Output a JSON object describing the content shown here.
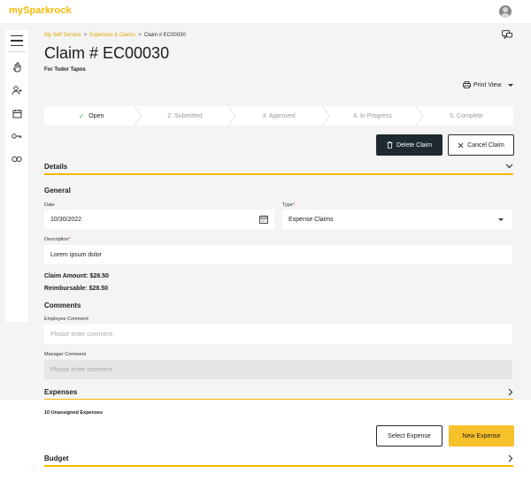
{
  "app": {
    "logo": "mySparkrock"
  },
  "breadcrumb": {
    "item1": "My Self Service",
    "item2": "Expenses & Claims",
    "item3": "Claim # EC00030",
    "sep": ">"
  },
  "header": {
    "title": "Claim # EC00030",
    "subtitle": "For Tudor Tapos",
    "print_view": "Print View"
  },
  "steps": [
    {
      "label": "Open"
    },
    {
      "label": "2. Submitted"
    },
    {
      "label": "3. Approved"
    },
    {
      "label": "4. In Progress"
    },
    {
      "label": "5. Complete"
    }
  ],
  "actions": {
    "delete": "Delete Claim",
    "cancel": "Cancel Claim"
  },
  "details": {
    "heading": "Details",
    "general": "General",
    "date_label": "Date",
    "date_value": "10/30/2022",
    "type_label": "Type",
    "type_required": "*",
    "type_value": "Expense Claims",
    "desc_label": "Description",
    "desc_required": "*",
    "desc_value": "Lorem ipsum dolor",
    "claim_amount": "Claim Amount: $28.50",
    "reimbursable": "Reimbursable: $28.50",
    "comments": "Comments",
    "emp_comment_label": "Employee Comment",
    "emp_comment_placeholder": "Please enter comment",
    "mgr_comment_label": "Manager Comment",
    "mgr_comment_placeholder": "Please enter comment"
  },
  "expenses": {
    "heading": "Expenses",
    "unassigned": "10 Unassigned Expenses",
    "select": "Select Expense",
    "new": "New Expense"
  },
  "budget": {
    "heading": "Budget"
  },
  "colors": {
    "accent": "#f5b800",
    "dark": "#1f2a30",
    "yellow_btn": "#f7c12b",
    "check": "#3aa85a"
  }
}
